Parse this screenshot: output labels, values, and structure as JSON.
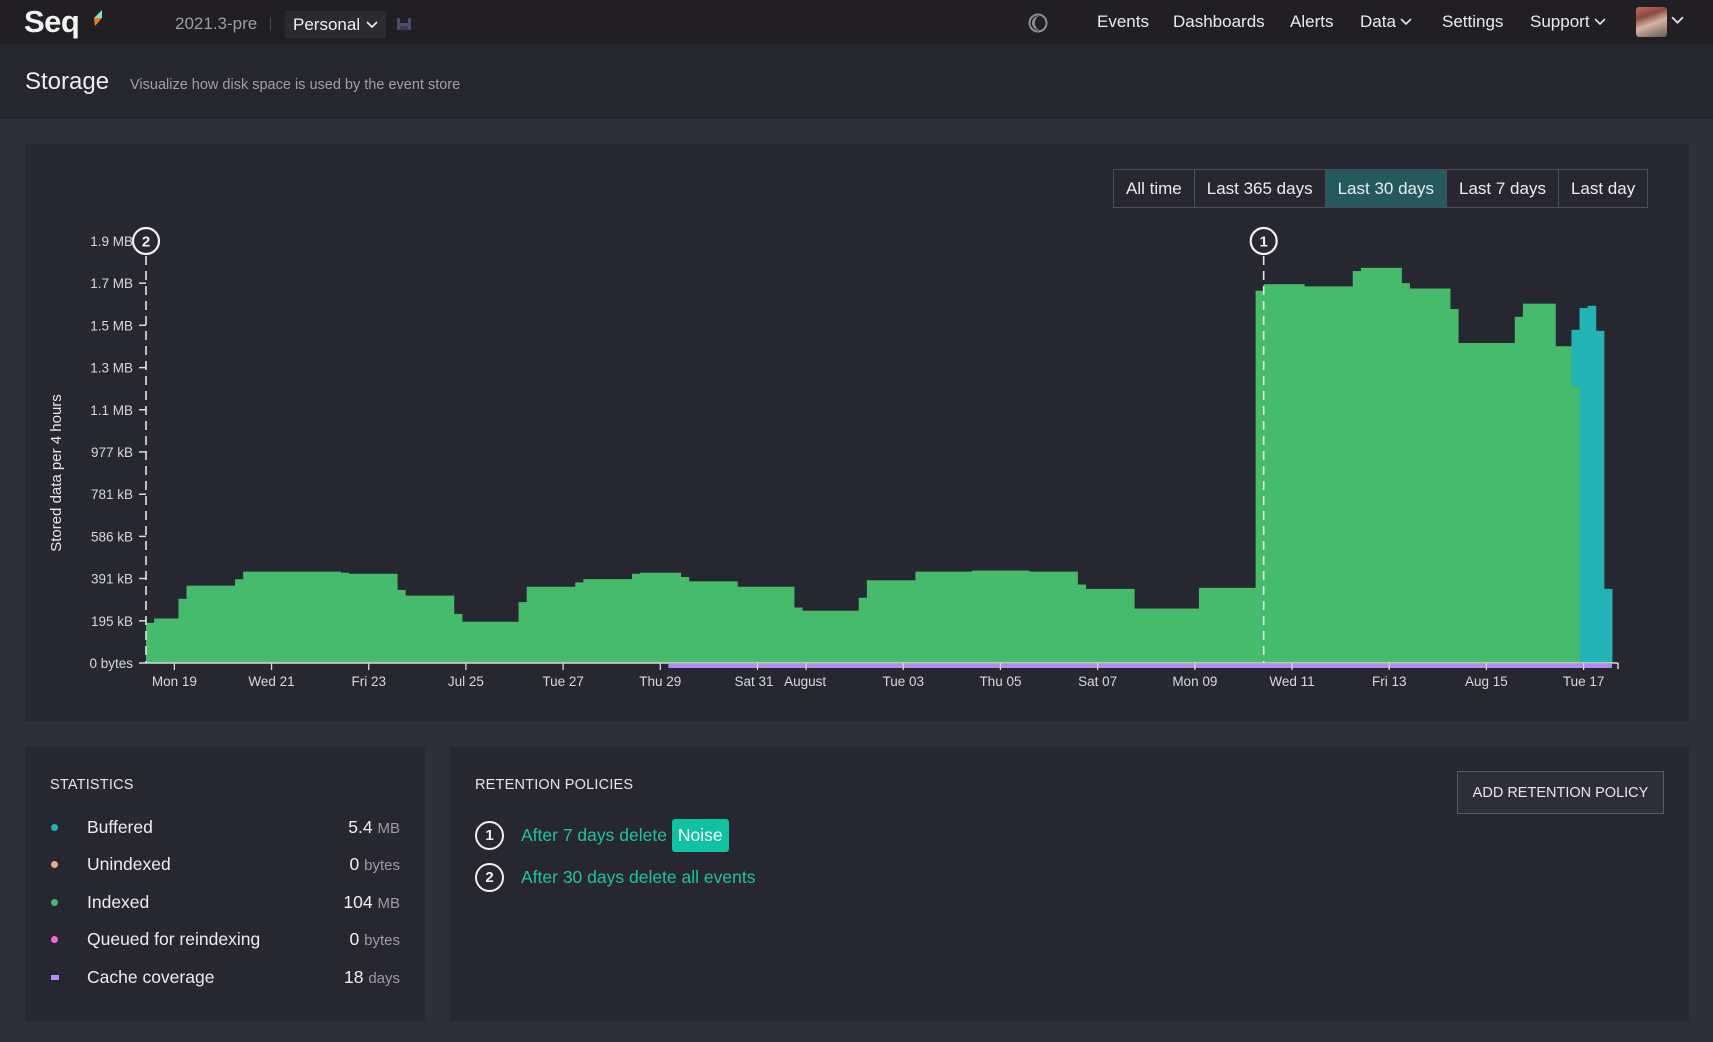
{
  "app": {
    "logo": "Seq",
    "version": "2021.3-pre",
    "workspace": "Personal"
  },
  "nav": {
    "items": [
      {
        "label": "Events"
      },
      {
        "label": "Dashboards"
      },
      {
        "label": "Alerts"
      },
      {
        "label": "Data",
        "dropdown": true
      },
      {
        "label": "Settings"
      },
      {
        "label": "Support",
        "dropdown": true
      }
    ]
  },
  "page": {
    "title": "Storage",
    "subtitle": "Visualize how disk space is used by the event store"
  },
  "ranges": {
    "options": [
      "All time",
      "Last 365 days",
      "Last 30 days",
      "Last 7 days",
      "Last day"
    ],
    "selected": "Last 30 days"
  },
  "colors": {
    "indexed": "#45bb6b",
    "buffered": "#22b3b6",
    "unindexed": "#f7a58a",
    "queued": "#f468d6",
    "cache": "#b58af5",
    "accent": "#1fc3a3"
  },
  "chart_data": {
    "type": "bar",
    "stacked": true,
    "ylabel": "Stored data per 4 hours",
    "xlabel": "",
    "ylim_kB": [
      0,
      1855
    ],
    "yticks": [
      {
        "label": "0 bytes",
        "value": 0
      },
      {
        "label": "195 kB",
        "value": 195
      },
      {
        "label": "391 kB",
        "value": 391
      },
      {
        "label": "586 kB",
        "value": 586
      },
      {
        "label": "781 kB",
        "value": 781
      },
      {
        "label": "977 kB",
        "value": 977
      },
      {
        "label": "1.1 MB",
        "value": 1172
      },
      {
        "label": "1.3 MB",
        "value": 1367
      },
      {
        "label": "1.5 MB",
        "value": 1563
      },
      {
        "label": "1.7 MB",
        "value": 1758
      },
      {
        "label": "1.9 MB",
        "value": 1953
      }
    ],
    "x_range_hours": [
      0,
      726
    ],
    "xticks": [
      {
        "label": "Mon 19",
        "hour": 14
      },
      {
        "label": "Wed 21",
        "hour": 62
      },
      {
        "label": "Fri 23",
        "hour": 110
      },
      {
        "label": "Jul 25",
        "hour": 158
      },
      {
        "label": "Tue 27",
        "hour": 206
      },
      {
        "label": "Thu 29",
        "hour": 254
      },
      {
        "label": "Sat 31",
        "hour": 302
      },
      {
        "label": "August",
        "hour": 326
      },
      {
        "label": "Tue 03",
        "hour": 374
      },
      {
        "label": "Thu 05",
        "hour": 422
      },
      {
        "label": "Sat 07",
        "hour": 470
      },
      {
        "label": "Mon 09",
        "hour": 518
      },
      {
        "label": "Wed 11",
        "hour": 566
      },
      {
        "label": "Fri 13",
        "hour": 614
      },
      {
        "label": "Aug 15",
        "hour": 662
      },
      {
        "label": "Tue 17",
        "hour": 710
      }
    ],
    "series": [
      {
        "name": "Indexed",
        "color": "#45bb6b",
        "segments": [
          [
            0,
            4,
            186
          ],
          [
            4,
            16,
            206
          ],
          [
            16,
            20,
            297
          ],
          [
            20,
            44,
            358
          ],
          [
            44,
            48,
            388
          ],
          [
            48,
            96,
            423
          ],
          [
            96,
            100,
            418
          ],
          [
            100,
            124,
            413
          ],
          [
            124,
            128,
            338
          ],
          [
            128,
            152,
            312
          ],
          [
            152,
            156,
            227
          ],
          [
            156,
            184,
            191
          ],
          [
            184,
            188,
            282
          ],
          [
            188,
            212,
            353
          ],
          [
            212,
            216,
            373
          ],
          [
            216,
            240,
            388
          ],
          [
            240,
            244,
            413
          ],
          [
            244,
            264,
            418
          ],
          [
            264,
            268,
            398
          ],
          [
            268,
            292,
            378
          ],
          [
            292,
            320,
            353
          ],
          [
            320,
            324,
            257
          ],
          [
            324,
            352,
            242
          ],
          [
            352,
            356,
            302
          ],
          [
            356,
            380,
            383
          ],
          [
            380,
            408,
            423
          ],
          [
            408,
            436,
            428
          ],
          [
            436,
            460,
            423
          ],
          [
            460,
            464,
            363
          ],
          [
            464,
            488,
            343
          ],
          [
            488,
            520,
            252
          ],
          [
            520,
            548,
            348
          ],
          [
            548,
            552,
            1723
          ],
          [
            552,
            572,
            1753
          ],
          [
            572,
            596,
            1743
          ],
          [
            596,
            600,
            1814
          ],
          [
            600,
            620,
            1829
          ],
          [
            620,
            624,
            1758
          ],
          [
            624,
            644,
            1733
          ],
          [
            644,
            648,
            1638
          ],
          [
            648,
            676,
            1481
          ],
          [
            676,
            680,
            1602
          ],
          [
            680,
            696,
            1663
          ],
          [
            696,
            704,
            1466
          ],
          [
            704,
            708,
            1281
          ]
        ]
      },
      {
        "name": "Buffered",
        "color": "#22b3b6",
        "segments": [
          [
            704,
            708,
            1542,
            "stack"
          ],
          [
            708,
            712,
            1643
          ],
          [
            712,
            716,
            1653
          ],
          [
            716,
            720,
            1537
          ],
          [
            720,
            724,
            343
          ]
        ]
      }
    ],
    "cache_coverage_hours": [
      258,
      724
    ],
    "annotations": [
      {
        "label": "2",
        "hour": 0,
        "policy": "After 30 days delete all events"
      },
      {
        "label": "1",
        "hour": 552,
        "policy": "After 7 days delete Noise"
      }
    ]
  },
  "statistics": {
    "title": "STATISTICS",
    "rows": [
      {
        "label": "Buffered",
        "value": "5.4",
        "unit": "MB",
        "color": "#22b3b6",
        "shape": "dot"
      },
      {
        "label": "Unindexed",
        "value": "0",
        "unit": "bytes",
        "color": "#f7a58a",
        "shape": "dot"
      },
      {
        "label": "Indexed",
        "value": "104",
        "unit": "MB",
        "color": "#45bb6b",
        "shape": "dot"
      },
      {
        "label": "Queued for reindexing",
        "value": "0",
        "unit": "bytes",
        "color": "#f468d6",
        "shape": "dot"
      },
      {
        "label": "Cache coverage",
        "value": "18",
        "unit": "days",
        "color": "#b58af5",
        "shape": "bar"
      }
    ]
  },
  "retention": {
    "title": "RETENTION POLICIES",
    "add_button": "ADD RETENTION POLICY",
    "policies": [
      {
        "number": "1",
        "text": "After 7 days delete",
        "tag": "Noise"
      },
      {
        "number": "2",
        "text": "After 30 days delete all events",
        "tag": null
      }
    ]
  }
}
